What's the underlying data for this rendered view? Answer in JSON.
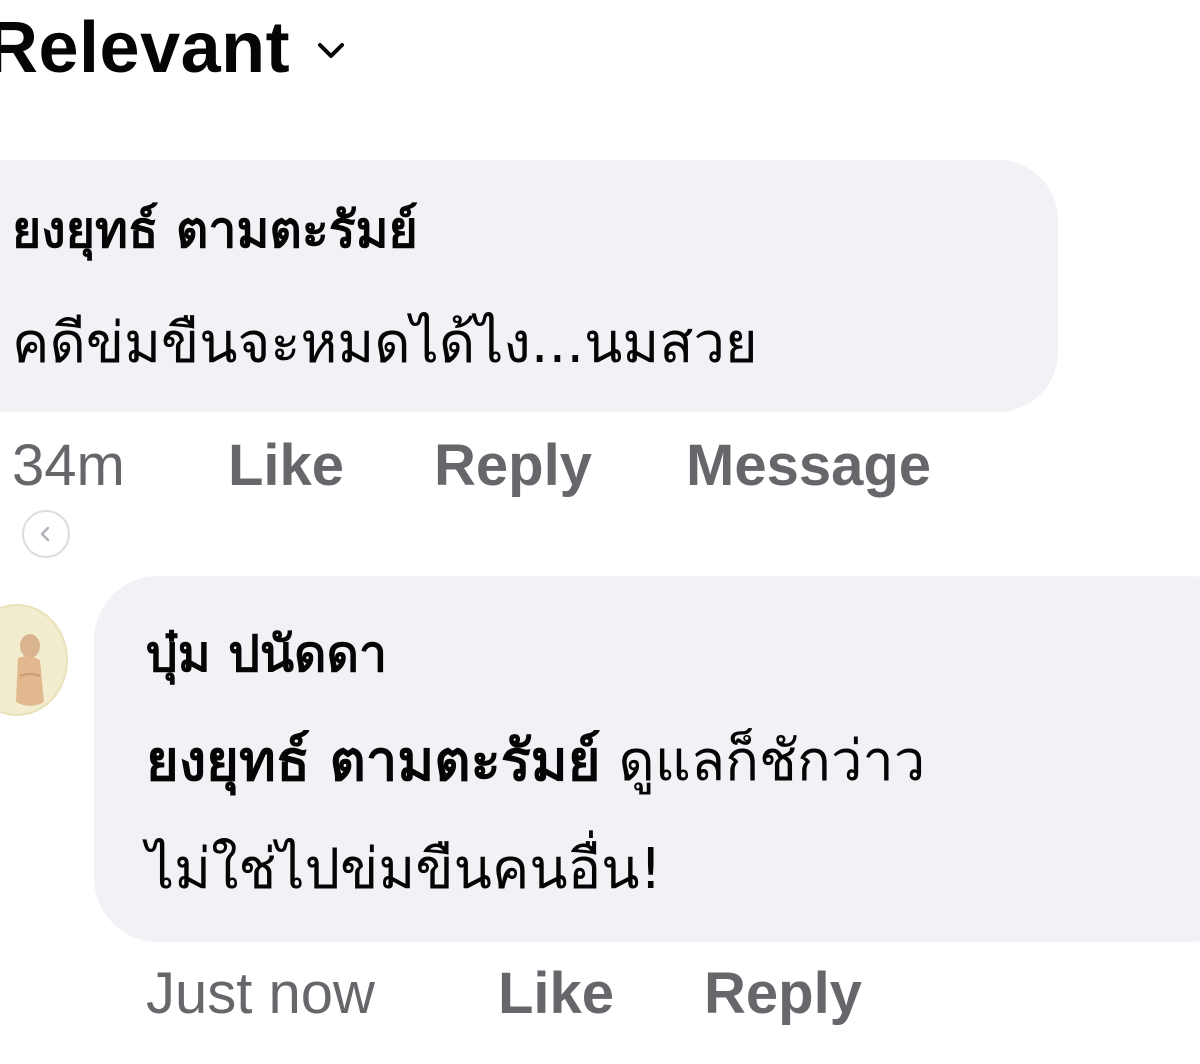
{
  "sort": {
    "label": "Relevant",
    "icon": "chevron-down-icon"
  },
  "comments": [
    {
      "author": "ยงยุทธ์ ตามตะรัมย์",
      "text": "คดีข่มขืนจะหมดได้ไง...นมสวย",
      "time": "34m",
      "actions": [
        "Like",
        "Reply",
        "Message"
      ]
    },
    {
      "author": "บุ๋ม ปนัดดา",
      "mention": "ยงยุทธ์ ตามตะรัมย์",
      "text_line1": "ดูแลก็ชักว่าว",
      "text_line2": "ไม่ใช่ไปข่มขืนคนอื่น!",
      "time": "Just now",
      "actions": [
        "Like",
        "Reply"
      ]
    }
  ],
  "colors": {
    "bubble": "#f0f2f5",
    "meta_text": "#65676b",
    "text": "#050505"
  }
}
